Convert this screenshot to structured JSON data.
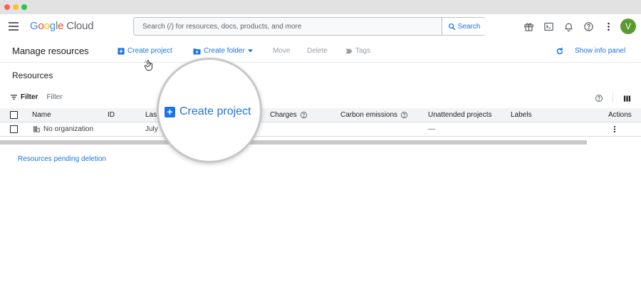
{
  "topbar": {
    "logo_letters": [
      "G",
      "o",
      "o",
      "g",
      "l",
      "e"
    ],
    "logo_product": "Cloud",
    "search_placeholder": "Search (/) for resources, docs, products, and more",
    "search_button": "Search",
    "avatar_letter": "V"
  },
  "actionbar": {
    "title": "Manage resources",
    "create_project": "Create project",
    "create_folder": "Create folder",
    "move": "Move",
    "delete": "Delete",
    "tags": "Tags",
    "show_info_panel": "Show info panel"
  },
  "resources": {
    "title": "Resources",
    "filter_label": "Filter",
    "filter_placeholder": "Filter",
    "columns": {
      "name": "Name",
      "id": "ID",
      "last": "Las",
      "charges": "Charges",
      "carbon": "Carbon emissions",
      "unattended": "Unattended projects",
      "labels": "Labels",
      "actions": "Actions"
    },
    "rows": [
      {
        "name": "No organization",
        "last": "July",
        "unattended": "—"
      }
    ],
    "pending_link": "Resources pending deletion"
  },
  "magnifier": {
    "label": "Create project"
  },
  "colors": {
    "accent": "#1a73e8",
    "avatar": "#5a9a2e"
  }
}
